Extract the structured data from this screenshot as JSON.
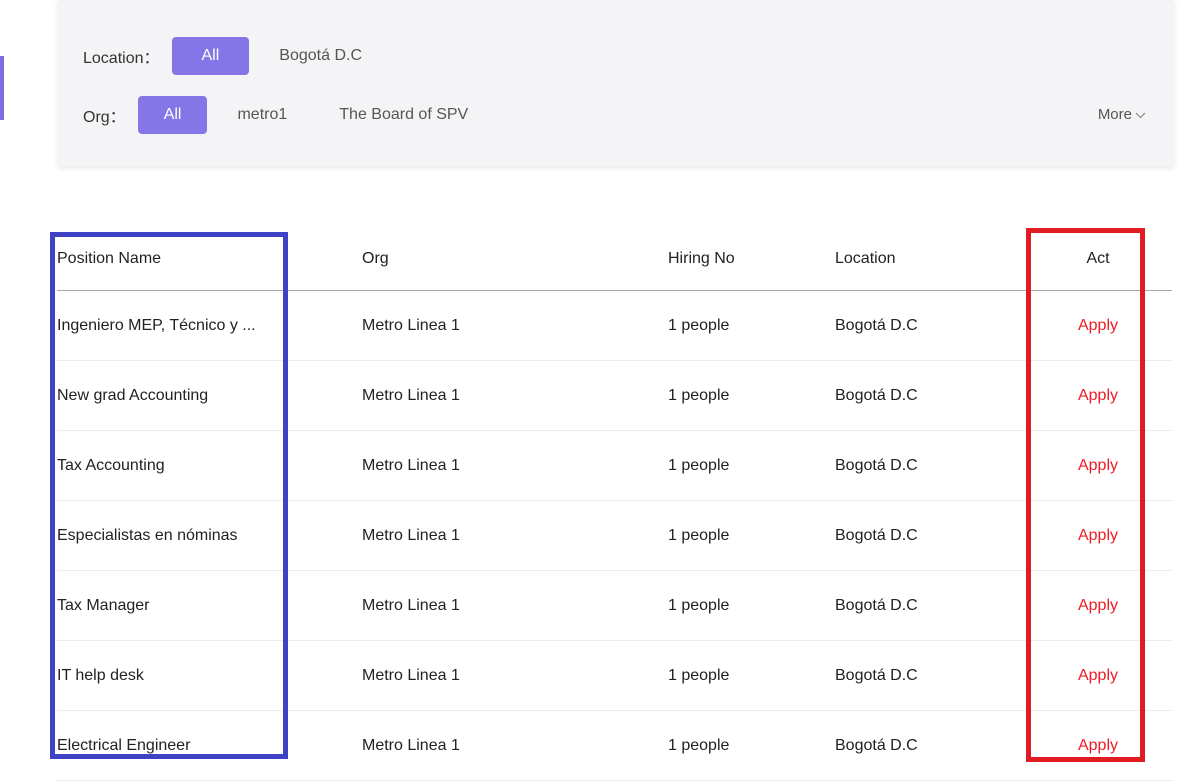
{
  "filters": {
    "location": {
      "label": "Location：",
      "options": [
        "All",
        "Bogotá D.C"
      ],
      "selected": "All"
    },
    "org": {
      "label": "Org：",
      "options": [
        "All",
        "metro1",
        "The Board of SPV"
      ],
      "selected": "All"
    },
    "more_label": "More"
  },
  "table": {
    "headers": [
      "Position Name",
      "Org",
      "Hiring No",
      "Location",
      "Act"
    ],
    "rows": [
      {
        "position": "Ingeniero MEP, Técnico y ...",
        "org": "Metro Linea 1",
        "hiring": "1 people",
        "location": "Bogotá D.C",
        "act": "Apply"
      },
      {
        "position": "New grad Accounting",
        "org": "Metro Linea 1",
        "hiring": "1 people",
        "location": "Bogotá D.C",
        "act": "Apply"
      },
      {
        "position": "Tax Accounting",
        "org": "Metro Linea 1",
        "hiring": "1 people",
        "location": "Bogotá D.C",
        "act": "Apply"
      },
      {
        "position": "Especialistas en nóminas",
        "org": "Metro Linea 1",
        "hiring": "1 people",
        "location": "Bogotá D.C",
        "act": "Apply"
      },
      {
        "position": "Tax Manager",
        "org": "Metro Linea 1",
        "hiring": "1 people",
        "location": "Bogotá D.C",
        "act": "Apply"
      },
      {
        "position": "IT help desk",
        "org": "Metro Linea 1",
        "hiring": "1 people",
        "location": "Bogotá D.C",
        "act": "Apply"
      },
      {
        "position": "Electrical Engineer",
        "org": "Metro Linea 1",
        "hiring": "1 people",
        "location": "Bogotá D.C",
        "act": "Apply"
      }
    ]
  },
  "colors": {
    "accent": "#8476e6",
    "apply_text": "#ee1c25",
    "highlight_blue": "#3f42c4",
    "highlight_red": "#e11b22"
  },
  "icons": {
    "more": "chevron-down-icon"
  }
}
